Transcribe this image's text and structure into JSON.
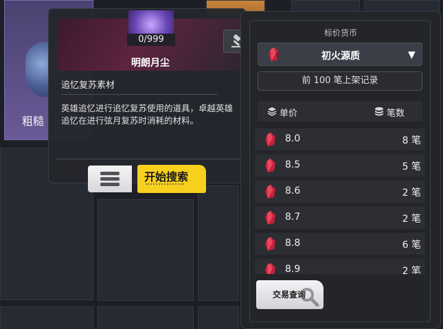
{
  "background_item": {
    "label": "粗糙"
  },
  "tooltip": {
    "item_count": "0/999",
    "item_name": "明朗月尘",
    "category": "追忆复苏素材",
    "description": "英雄追忆进行追忆复苏使用的道具，卓越英雄追忆在进行弦月复苏时消耗的材料。",
    "search_button_label": "开始搜索"
  },
  "panel": {
    "currency_label": "标价货币",
    "currency_selected": "初火源质",
    "records_button_label": "前 100 笔上架记录",
    "column_price": "单价",
    "column_count": "笔数",
    "listings": [
      {
        "price": "8.0",
        "count": "8 笔"
      },
      {
        "price": "8.5",
        "count": "5 笔"
      },
      {
        "price": "8.6",
        "count": "2 笔"
      },
      {
        "price": "8.7",
        "count": "2 笔"
      },
      {
        "price": "8.8",
        "count": "6 笔"
      },
      {
        "price": "8.9",
        "count": "2 笔"
      }
    ],
    "query_button_label": "交易查询"
  },
  "colors": {
    "accent_yellow": "#f7cf1d",
    "gem_red": "#c8203a",
    "panel_bg": "#232529"
  },
  "icons": {
    "auction": "gavel-icon",
    "menu": "menu-icon",
    "currency": "red-crystal-icon",
    "dropdown": "triangle-down-icon",
    "price_header": "stack-icon",
    "count_header": "coins-icon",
    "query": "magnifier-icon"
  }
}
